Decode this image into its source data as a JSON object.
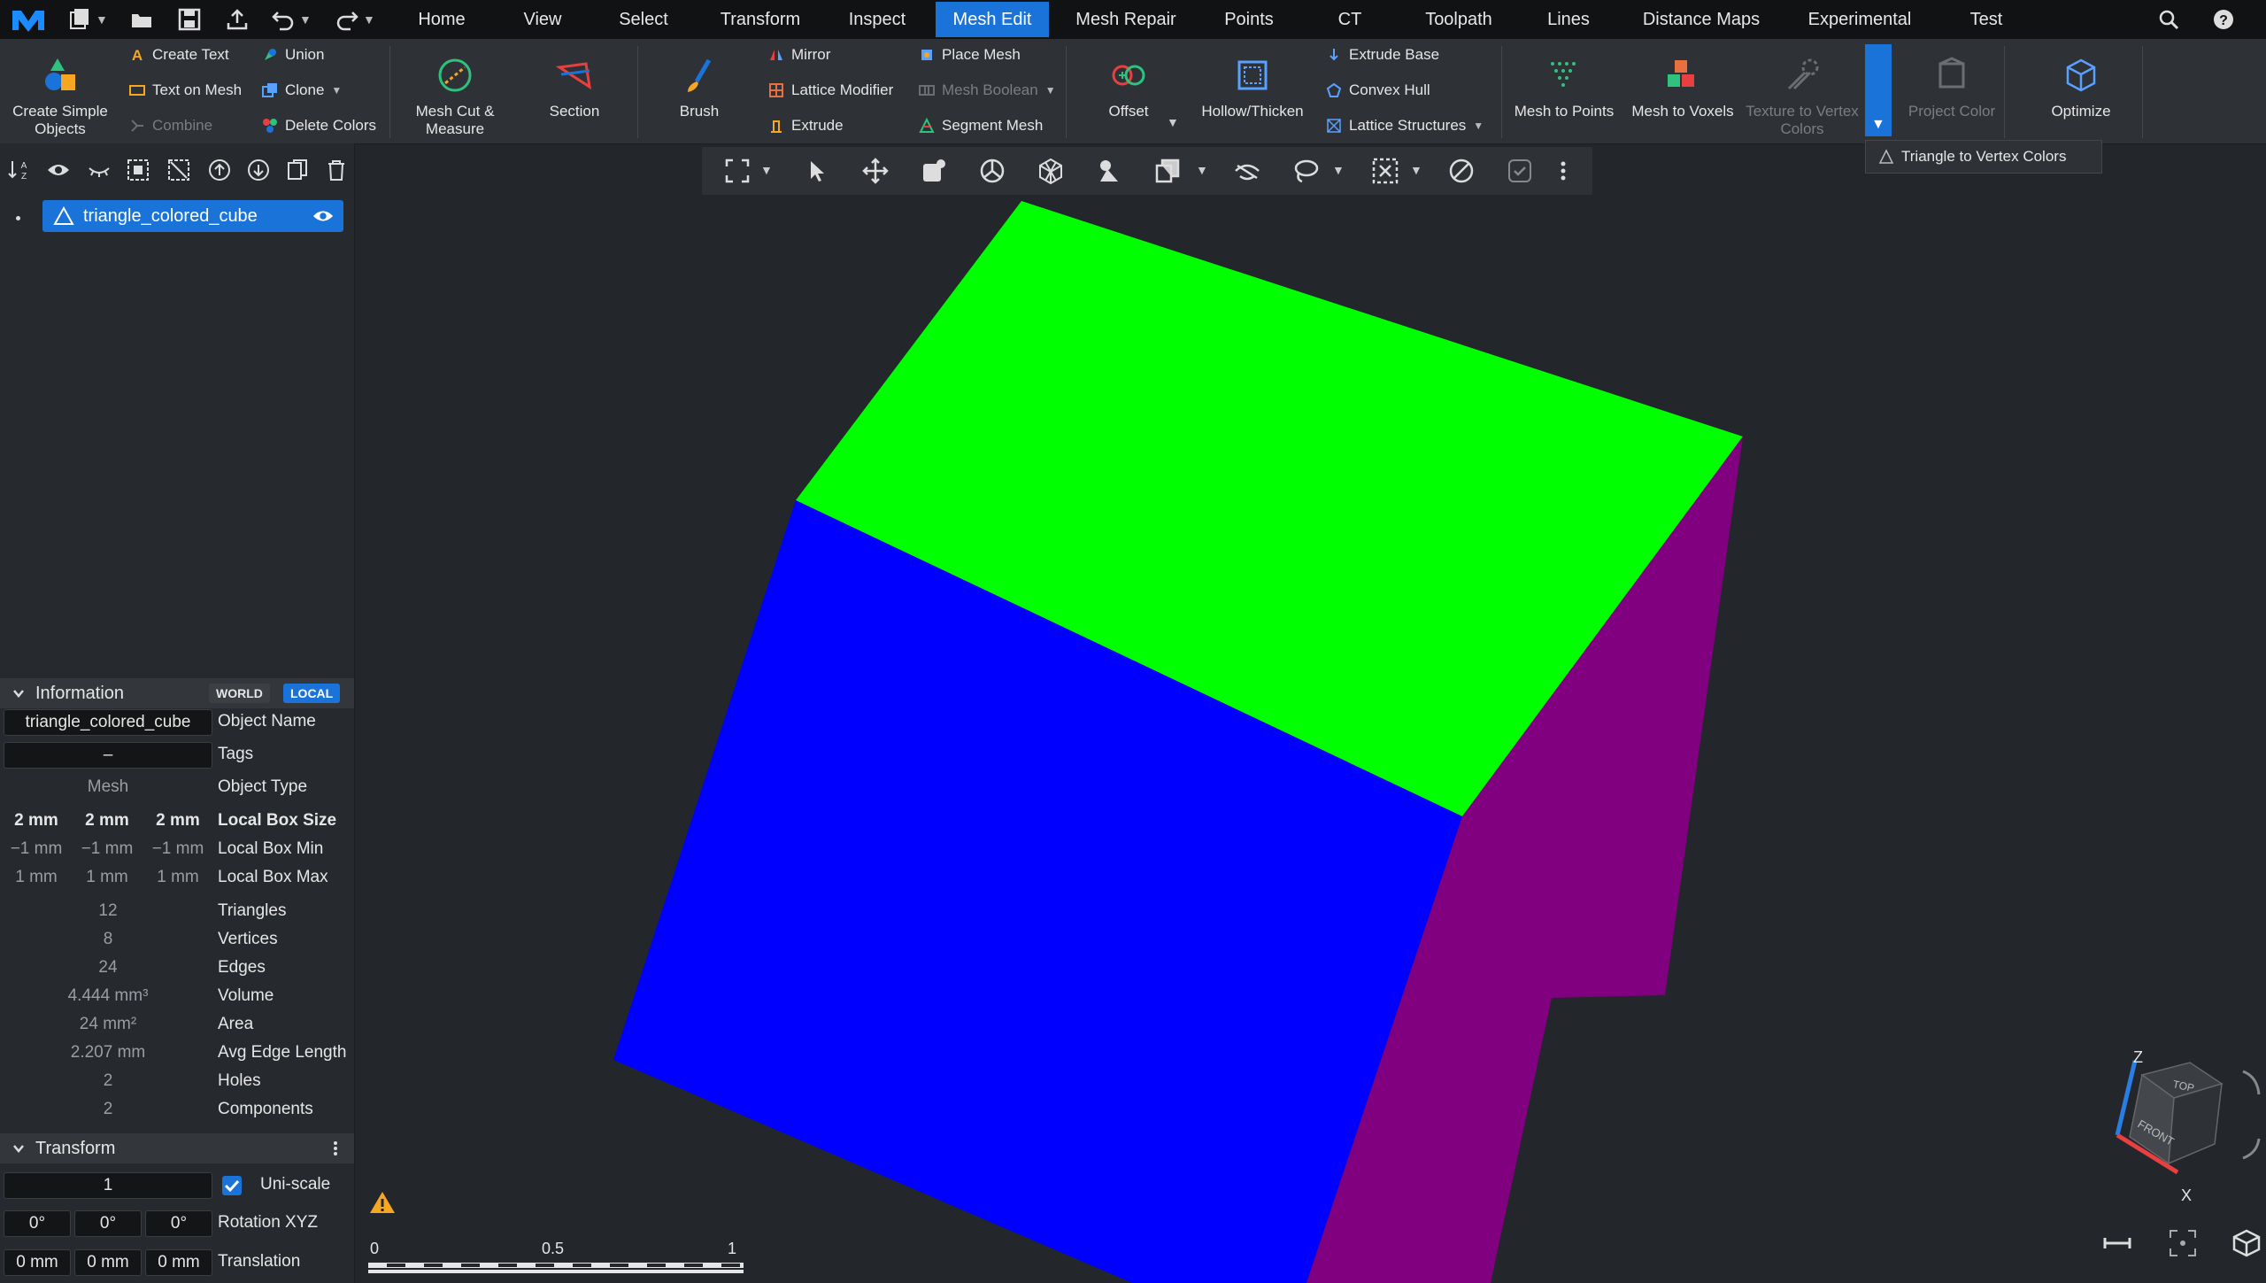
{
  "menu_tabs": [
    "Home",
    "View",
    "Select",
    "Transform",
    "Inspect",
    "Mesh Edit",
    "Mesh Repair",
    "Points",
    "CT",
    "Toolpath",
    "Lines",
    "Distance Maps",
    "Experimental",
    "Test"
  ],
  "active_tab": "Mesh Edit",
  "ribbon": {
    "create_simple_objects": "Create Simple Objects",
    "create_text": "Create Text",
    "text_on_mesh": "Text on Mesh",
    "combine": "Combine",
    "union": "Union",
    "clone": "Clone",
    "delete_colors": "Delete Colors",
    "mesh_cut": "Mesh Cut & Measure",
    "section": "Section",
    "brush": "Brush",
    "mirror": "Mirror",
    "lattice_modifier": "Lattice Modifier",
    "extrude": "Extrude",
    "place_mesh": "Place Mesh",
    "mesh_boolean": "Mesh Boolean",
    "segment_mesh": "Segment Mesh",
    "offset": "Offset",
    "hollow_thicken": "Hollow/Thicken",
    "extrude_base": "Extrude Base",
    "convex_hull": "Convex Hull",
    "lattice_structures": "Lattice Structures",
    "mesh_to_points": "Mesh to Points",
    "mesh_to_voxels": "Mesh to Voxels",
    "texture_to_vertex": "Texture to Vertex Colors",
    "project_color": "Project Color",
    "optimize": "Optimize",
    "dropdown_item": "Triangle to Vertex Colors"
  },
  "scene": {
    "object_name": "triangle_colored_cube"
  },
  "information": {
    "title": "Information",
    "world": "WORLD",
    "local": "LOCAL",
    "object_name_value": "triangle_colored_cube",
    "object_name_label": "Object Name",
    "tags_value": "–",
    "tags_label": "Tags",
    "object_type_value": "Mesh",
    "object_type_label": "Object Type",
    "box_size": [
      "2 mm",
      "2 mm",
      "2 mm"
    ],
    "box_size_label": "Local Box Size",
    "box_min": [
      "−1 mm",
      "−1 mm",
      "−1 mm"
    ],
    "box_min_label": "Local Box Min",
    "box_max": [
      "1 mm",
      "1 mm",
      "1 mm"
    ],
    "box_max_label": "Local Box Max",
    "stats": [
      {
        "value": "12",
        "label": "Triangles"
      },
      {
        "value": "8",
        "label": "Vertices"
      },
      {
        "value": "24",
        "label": "Edges"
      },
      {
        "value": "4.444 mm³",
        "label": "Volume"
      },
      {
        "value": "24 mm²",
        "label": "Area"
      },
      {
        "value": "2.207 mm",
        "label": "Avg Edge Length"
      },
      {
        "value": "2",
        "label": "Holes"
      },
      {
        "value": "2",
        "label": "Components"
      }
    ]
  },
  "transform": {
    "title": "Transform",
    "scale_value": "1",
    "uniscale_label": "Uni-scale",
    "uniscale_checked": true,
    "rotation": [
      "0°",
      "0°",
      "0°"
    ],
    "rotation_label": "Rotation XYZ",
    "translation": [
      "0 mm",
      "0 mm",
      "0 mm"
    ],
    "translation_label": "Translation"
  },
  "ruler": {
    "ticks": [
      "0",
      "0.5",
      "1"
    ]
  },
  "navcube": {
    "top": "TOP",
    "front": "FRONT",
    "axis_z": "Z",
    "axis_x": "X"
  },
  "colors": {
    "accent": "#1a73d9",
    "cube_top": "#00ff00",
    "cube_front": "#0000ff",
    "cube_side": "#800080",
    "viewport_bg": "#23262b"
  }
}
